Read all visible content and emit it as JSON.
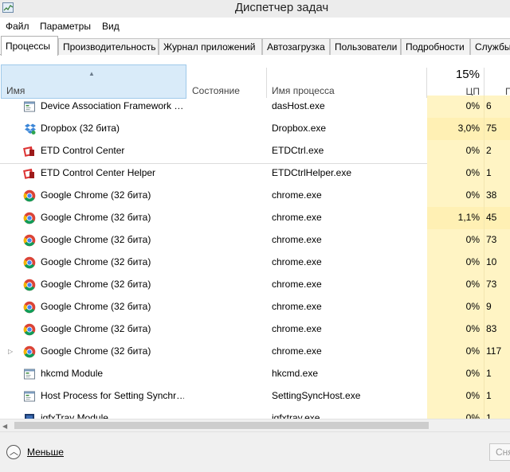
{
  "window": {
    "title": "Диспетчер задач"
  },
  "menu": [
    "Файл",
    "Параметры",
    "Вид"
  ],
  "tabs": [
    {
      "label": "Процессы",
      "active": true
    },
    {
      "label": "Производительность"
    },
    {
      "label": "Журнал приложений"
    },
    {
      "label": "Автозагрузка"
    },
    {
      "label": "Пользователи"
    },
    {
      "label": "Подробности"
    },
    {
      "label": "Службы"
    }
  ],
  "columns": {
    "name": "Имя",
    "status": "Состояние",
    "process_name": "Имя процесса",
    "cpu_total": "15%",
    "cpu": "ЦП",
    "memory": "П"
  },
  "rows": [
    {
      "name": "Device Association Framework …",
      "exe": "dasHost.exe",
      "cpu": "0%",
      "mem": "6",
      "icon": "service-icon"
    },
    {
      "name": "Dropbox (32 бита)",
      "exe": "Dropbox.exe",
      "cpu": "3,0%",
      "mem": "75",
      "icon": "dropbox-icon",
      "hot": true
    },
    {
      "name": "ETD Control Center",
      "exe": "ETDCtrl.exe",
      "cpu": "0%",
      "mem": "2",
      "icon": "etd-icon"
    },
    {
      "name": "ETD Control Center Helper",
      "exe": "ETDCtrlHelper.exe",
      "cpu": "0%",
      "mem": "1",
      "icon": "etd-icon"
    },
    {
      "name": "Google Chrome (32 бита)",
      "exe": "chrome.exe",
      "cpu": "0%",
      "mem": "38",
      "icon": "chrome-icon"
    },
    {
      "name": "Google Chrome (32 бита)",
      "exe": "chrome.exe",
      "cpu": "1,1%",
      "mem": "45",
      "icon": "chrome-icon",
      "hot": true
    },
    {
      "name": "Google Chrome (32 бита)",
      "exe": "chrome.exe",
      "cpu": "0%",
      "mem": "73",
      "icon": "chrome-icon"
    },
    {
      "name": "Google Chrome (32 бита)",
      "exe": "chrome.exe",
      "cpu": "0%",
      "mem": "10",
      "icon": "chrome-icon"
    },
    {
      "name": "Google Chrome (32 бита)",
      "exe": "chrome.exe",
      "cpu": "0%",
      "mem": "73",
      "icon": "chrome-icon"
    },
    {
      "name": "Google Chrome (32 бита)",
      "exe": "chrome.exe",
      "cpu": "0%",
      "mem": "9",
      "icon": "chrome-icon"
    },
    {
      "name": "Google Chrome (32 бита)",
      "exe": "chrome.exe",
      "cpu": "0%",
      "mem": "83",
      "icon": "chrome-icon"
    },
    {
      "name": "Google Chrome (32 бита)",
      "exe": "chrome.exe",
      "cpu": "0%",
      "mem": "117",
      "icon": "chrome-icon",
      "expandable": true
    },
    {
      "name": "hkcmd Module",
      "exe": "hkcmd.exe",
      "cpu": "0%",
      "mem": "1",
      "icon": "service-icon"
    },
    {
      "name": "Host Process for Setting Synchr…",
      "exe": "SettingSyncHost.exe",
      "cpu": "0%",
      "mem": "1",
      "icon": "service-icon"
    },
    {
      "name": "igfxTray Module",
      "exe": "igfxtray.exe",
      "cpu": "0%",
      "mem": "1",
      "icon": "igfx-icon"
    }
  ],
  "footer": {
    "less_label": "Меньше",
    "end_task_label": "Снять задачу"
  },
  "colors": {
    "header_selected": "#d9ebf9",
    "cpu_heat": "#fff4c4",
    "cpu_heat_hot": "#fff0b4"
  }
}
